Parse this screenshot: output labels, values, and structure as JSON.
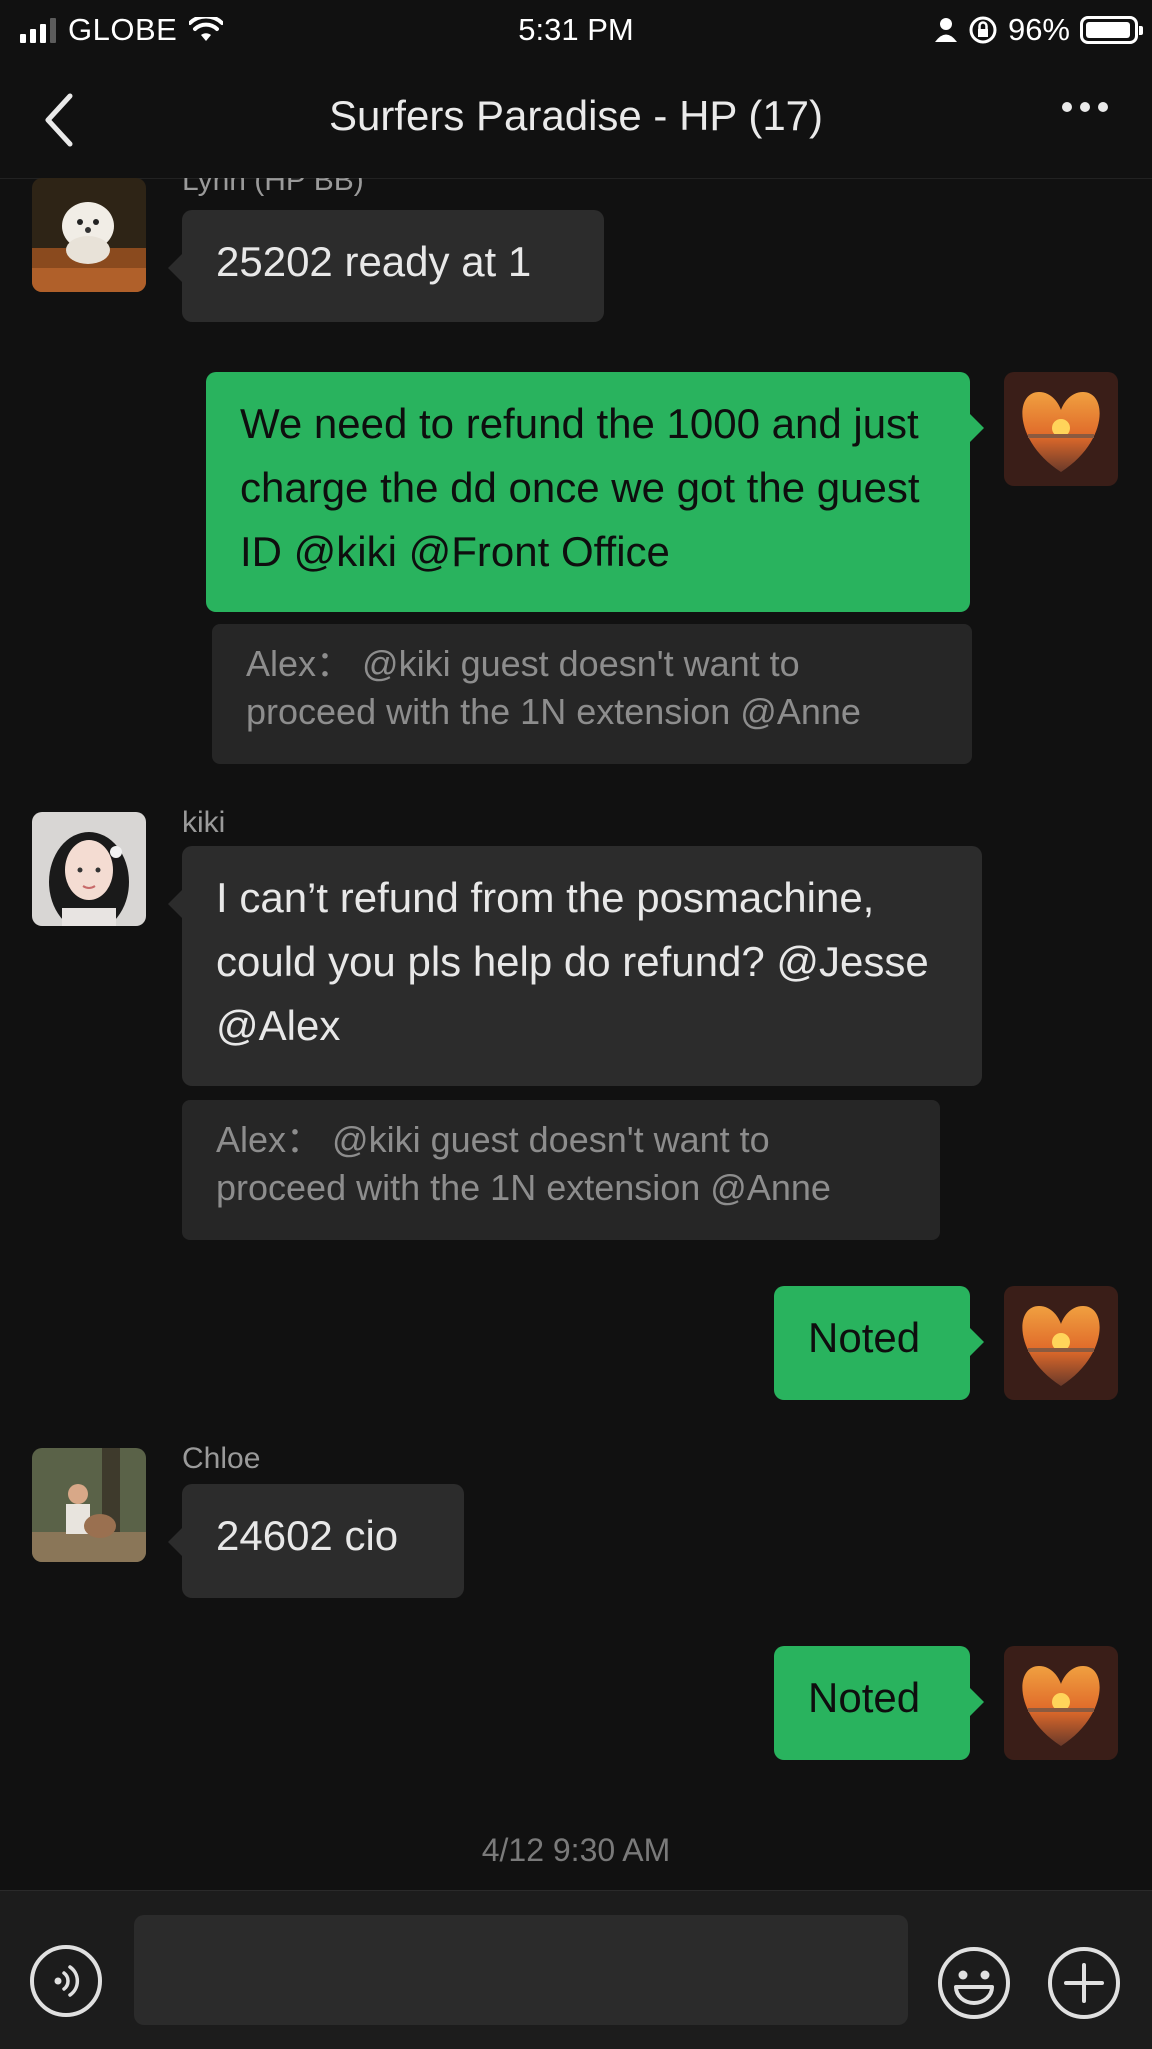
{
  "status_bar": {
    "carrier": "GLOBE",
    "time": "5:31 PM",
    "battery": "96%"
  },
  "nav": {
    "title": "Surfers Paradise - HP (17)"
  },
  "messages": [
    {
      "sender": "Lynn (HP BB)",
      "text": "25202 ready at 1"
    },
    {
      "text": "We need to refund the 1000 and just charge the dd once we got the guest ID @kiki @Front Office"
    },
    {
      "sender": "kiki",
      "text": "I can’t refund from the posmachine, could you pls help do refund? @Jesse @Alex"
    },
    {
      "text": "Noted"
    },
    {
      "sender": "Chloe",
      "text": "24602 cio"
    },
    {
      "text": "Noted"
    }
  ],
  "quotes": [
    "Alex： @kiki guest doesn't want to proceed with the 1N extension @Anne",
    "Alex： @kiki guest doesn't want to proceed with the 1N extension @Anne"
  ],
  "timestamp": "4/12 9:30 AM",
  "input": {
    "value": ""
  },
  "colors": {
    "background": "#111111",
    "incoming_bubble": "#2c2c2c",
    "outgoing_bubble": "#29b35e"
  },
  "icons": [
    "back-chevron-icon",
    "more-dots-icon",
    "voice-icon",
    "emoji-icon",
    "plus-icon",
    "wifi-icon",
    "signal-icon",
    "battery-icon",
    "rotation-lock-icon",
    "person-icon"
  ]
}
